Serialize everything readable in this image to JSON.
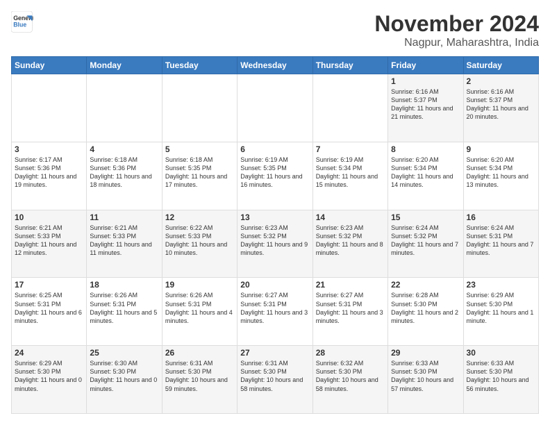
{
  "logo": {
    "line1": "General",
    "line2": "Blue"
  },
  "title": "November 2024",
  "subtitle": "Nagpur, Maharashtra, India",
  "weekdays": [
    "Sunday",
    "Monday",
    "Tuesday",
    "Wednesday",
    "Thursday",
    "Friday",
    "Saturday"
  ],
  "weeks": [
    [
      {
        "day": "",
        "info": ""
      },
      {
        "day": "",
        "info": ""
      },
      {
        "day": "",
        "info": ""
      },
      {
        "day": "",
        "info": ""
      },
      {
        "day": "",
        "info": ""
      },
      {
        "day": "1",
        "info": "Sunrise: 6:16 AM\nSunset: 5:37 PM\nDaylight: 11 hours and 21 minutes."
      },
      {
        "day": "2",
        "info": "Sunrise: 6:16 AM\nSunset: 5:37 PM\nDaylight: 11 hours and 20 minutes."
      }
    ],
    [
      {
        "day": "3",
        "info": "Sunrise: 6:17 AM\nSunset: 5:36 PM\nDaylight: 11 hours and 19 minutes."
      },
      {
        "day": "4",
        "info": "Sunrise: 6:18 AM\nSunset: 5:36 PM\nDaylight: 11 hours and 18 minutes."
      },
      {
        "day": "5",
        "info": "Sunrise: 6:18 AM\nSunset: 5:35 PM\nDaylight: 11 hours and 17 minutes."
      },
      {
        "day": "6",
        "info": "Sunrise: 6:19 AM\nSunset: 5:35 PM\nDaylight: 11 hours and 16 minutes."
      },
      {
        "day": "7",
        "info": "Sunrise: 6:19 AM\nSunset: 5:34 PM\nDaylight: 11 hours and 15 minutes."
      },
      {
        "day": "8",
        "info": "Sunrise: 6:20 AM\nSunset: 5:34 PM\nDaylight: 11 hours and 14 minutes."
      },
      {
        "day": "9",
        "info": "Sunrise: 6:20 AM\nSunset: 5:34 PM\nDaylight: 11 hours and 13 minutes."
      }
    ],
    [
      {
        "day": "10",
        "info": "Sunrise: 6:21 AM\nSunset: 5:33 PM\nDaylight: 11 hours and 12 minutes."
      },
      {
        "day": "11",
        "info": "Sunrise: 6:21 AM\nSunset: 5:33 PM\nDaylight: 11 hours and 11 minutes."
      },
      {
        "day": "12",
        "info": "Sunrise: 6:22 AM\nSunset: 5:33 PM\nDaylight: 11 hours and 10 minutes."
      },
      {
        "day": "13",
        "info": "Sunrise: 6:23 AM\nSunset: 5:32 PM\nDaylight: 11 hours and 9 minutes."
      },
      {
        "day": "14",
        "info": "Sunrise: 6:23 AM\nSunset: 5:32 PM\nDaylight: 11 hours and 8 minutes."
      },
      {
        "day": "15",
        "info": "Sunrise: 6:24 AM\nSunset: 5:32 PM\nDaylight: 11 hours and 7 minutes."
      },
      {
        "day": "16",
        "info": "Sunrise: 6:24 AM\nSunset: 5:31 PM\nDaylight: 11 hours and 7 minutes."
      }
    ],
    [
      {
        "day": "17",
        "info": "Sunrise: 6:25 AM\nSunset: 5:31 PM\nDaylight: 11 hours and 6 minutes."
      },
      {
        "day": "18",
        "info": "Sunrise: 6:26 AM\nSunset: 5:31 PM\nDaylight: 11 hours and 5 minutes."
      },
      {
        "day": "19",
        "info": "Sunrise: 6:26 AM\nSunset: 5:31 PM\nDaylight: 11 hours and 4 minutes."
      },
      {
        "day": "20",
        "info": "Sunrise: 6:27 AM\nSunset: 5:31 PM\nDaylight: 11 hours and 3 minutes."
      },
      {
        "day": "21",
        "info": "Sunrise: 6:27 AM\nSunset: 5:31 PM\nDaylight: 11 hours and 3 minutes."
      },
      {
        "day": "22",
        "info": "Sunrise: 6:28 AM\nSunset: 5:30 PM\nDaylight: 11 hours and 2 minutes."
      },
      {
        "day": "23",
        "info": "Sunrise: 6:29 AM\nSunset: 5:30 PM\nDaylight: 11 hours and 1 minute."
      }
    ],
    [
      {
        "day": "24",
        "info": "Sunrise: 6:29 AM\nSunset: 5:30 PM\nDaylight: 11 hours and 0 minutes."
      },
      {
        "day": "25",
        "info": "Sunrise: 6:30 AM\nSunset: 5:30 PM\nDaylight: 11 hours and 0 minutes."
      },
      {
        "day": "26",
        "info": "Sunrise: 6:31 AM\nSunset: 5:30 PM\nDaylight: 10 hours and 59 minutes."
      },
      {
        "day": "27",
        "info": "Sunrise: 6:31 AM\nSunset: 5:30 PM\nDaylight: 10 hours and 58 minutes."
      },
      {
        "day": "28",
        "info": "Sunrise: 6:32 AM\nSunset: 5:30 PM\nDaylight: 10 hours and 58 minutes."
      },
      {
        "day": "29",
        "info": "Sunrise: 6:33 AM\nSunset: 5:30 PM\nDaylight: 10 hours and 57 minutes."
      },
      {
        "day": "30",
        "info": "Sunrise: 6:33 AM\nSunset: 5:30 PM\nDaylight: 10 hours and 56 minutes."
      }
    ]
  ]
}
